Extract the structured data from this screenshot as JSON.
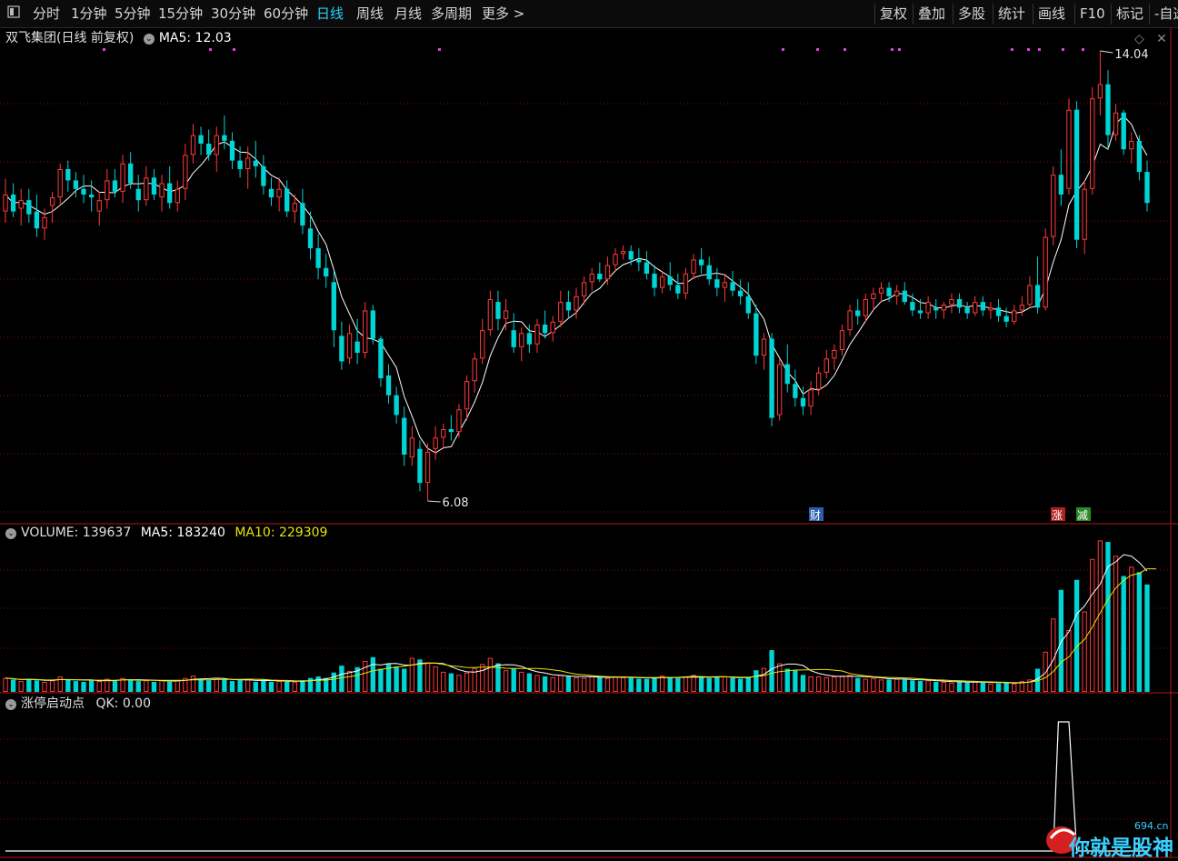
{
  "toolbar": {
    "left_tabs": [
      "分时",
      "1分钟",
      "5分钟",
      "15分钟",
      "30分钟",
      "60分钟",
      "日线",
      "周线",
      "月线",
      "多周期",
      "更多 >"
    ],
    "active_tab": "日线",
    "right_buttons": [
      "复权",
      "叠加",
      "多股",
      "统计",
      "画线",
      "F10",
      "标记",
      "-自选"
    ]
  },
  "price_panel": {
    "title": "双飞集团(日线 前复权)",
    "ma_label": "MA5: 12.03",
    "high_marker": "14.04",
    "low_marker": "6.08",
    "event_badges": [
      "财",
      "涨",
      "减"
    ]
  },
  "volume_panel": {
    "label": "VOLUME: 139637",
    "ma5_label": "MA5: 183240",
    "ma10_label": "MA10: 229309"
  },
  "indicator_panel": {
    "label": "涨停启动点",
    "qk_label": "QK: 0.00"
  },
  "watermark": {
    "text": "你就是股神",
    "site": "694.cn"
  },
  "colors": {
    "up": "#ff3a3a",
    "down": "#00d4d4",
    "ma5": "#ffffff",
    "ma10": "#e6e600",
    "active_tab": "#28d4ff",
    "marker_dot": "#e040e0"
  },
  "chart_data": [
    {
      "type": "candlestick",
      "title": "双飞集团(日线 前复权)",
      "ohlc": [
        [
          11.2,
          11.78,
          11.0,
          11.5
        ],
        [
          11.5,
          11.7,
          11.1,
          11.2
        ],
        [
          11.25,
          11.6,
          10.95,
          11.4
        ],
        [
          11.4,
          11.6,
          11.0,
          11.15
        ],
        [
          11.2,
          11.5,
          10.75,
          10.9
        ],
        [
          10.9,
          11.25,
          10.7,
          11.1
        ],
        [
          11.3,
          11.55,
          11.0,
          11.45
        ],
        [
          11.45,
          12.05,
          11.3,
          11.95
        ],
        [
          11.95,
          12.1,
          11.55,
          11.75
        ],
        [
          11.75,
          11.9,
          11.45,
          11.6
        ],
        [
          11.6,
          11.85,
          11.35,
          11.5
        ],
        [
          11.5,
          11.75,
          11.2,
          11.45
        ],
        [
          11.2,
          11.55,
          10.95,
          11.4
        ],
        [
          11.4,
          11.95,
          11.25,
          11.75
        ],
        [
          11.75,
          11.95,
          11.45,
          11.55
        ],
        [
          11.55,
          12.2,
          11.35,
          12.05
        ],
        [
          12.05,
          12.25,
          11.6,
          11.7
        ],
        [
          11.6,
          11.85,
          11.2,
          11.4
        ],
        [
          11.4,
          12.0,
          11.3,
          11.8
        ],
        [
          11.8,
          11.95,
          11.4,
          11.5
        ],
        [
          11.45,
          11.85,
          11.2,
          11.7
        ],
        [
          11.7,
          12.0,
          11.25,
          11.35
        ],
        [
          11.35,
          11.75,
          11.2,
          11.6
        ],
        [
          11.6,
          12.4,
          11.4,
          12.2
        ],
        [
          12.2,
          12.75,
          12.05,
          12.55
        ],
        [
          12.55,
          12.7,
          12.2,
          12.4
        ],
        [
          12.4,
          12.65,
          12.1,
          12.2
        ],
        [
          12.2,
          12.7,
          11.9,
          12.55
        ],
        [
          12.55,
          12.9,
          12.3,
          12.45
        ],
        [
          12.45,
          12.6,
          11.95,
          12.1
        ],
        [
          12.1,
          12.35,
          11.8,
          11.95
        ],
        [
          11.95,
          12.35,
          11.6,
          12.15
        ],
        [
          12.1,
          12.45,
          11.8,
          12.0
        ],
        [
          12.0,
          12.2,
          11.5,
          11.65
        ],
        [
          11.6,
          11.8,
          11.3,
          11.45
        ],
        [
          11.45,
          11.8,
          11.2,
          11.6
        ],
        [
          11.6,
          11.75,
          11.1,
          11.2
        ],
        [
          11.2,
          11.5,
          11.0,
          11.35
        ],
        [
          11.35,
          11.6,
          10.8,
          10.95
        ],
        [
          10.9,
          11.2,
          10.35,
          10.55
        ],
        [
          10.55,
          10.8,
          10.0,
          10.2
        ],
        [
          10.2,
          10.45,
          9.85,
          10.05
        ],
        [
          9.95,
          10.15,
          8.8,
          9.1
        ],
        [
          9.0,
          9.25,
          8.4,
          8.55
        ],
        [
          8.6,
          9.2,
          8.5,
          9.05
        ],
        [
          8.9,
          9.3,
          8.5,
          8.7
        ],
        [
          8.7,
          9.6,
          8.6,
          9.45
        ],
        [
          9.45,
          9.55,
          8.85,
          8.95
        ],
        [
          8.95,
          9.0,
          8.1,
          8.25
        ],
        [
          8.3,
          8.5,
          7.8,
          7.95
        ],
        [
          7.95,
          8.1,
          7.45,
          7.6
        ],
        [
          7.55,
          7.75,
          6.7,
          6.9
        ],
        [
          6.85,
          7.4,
          6.7,
          7.2
        ],
        [
          7.0,
          7.15,
          6.25,
          6.4
        ],
        [
          6.4,
          7.1,
          6.08,
          6.95
        ],
        [
          7.0,
          7.4,
          6.8,
          7.2
        ],
        [
          7.2,
          7.45,
          7.0,
          7.35
        ],
        [
          7.35,
          7.6,
          7.15,
          7.3
        ],
        [
          7.3,
          7.8,
          7.2,
          7.7
        ],
        [
          7.7,
          8.3,
          7.5,
          8.2
        ],
        [
          8.2,
          8.7,
          8.0,
          8.6
        ],
        [
          8.6,
          9.3,
          8.5,
          9.1
        ],
        [
          9.1,
          9.8,
          9.0,
          9.65
        ],
        [
          9.6,
          9.8,
          9.1,
          9.3
        ],
        [
          9.3,
          9.65,
          9.1,
          9.45
        ],
        [
          9.1,
          9.4,
          8.7,
          8.8
        ],
        [
          8.8,
          9.15,
          8.55,
          9.05
        ],
        [
          9.05,
          9.2,
          8.7,
          8.85
        ],
        [
          8.85,
          9.3,
          8.7,
          9.2
        ],
        [
          9.2,
          9.45,
          8.95,
          9.05
        ],
        [
          9.05,
          9.35,
          8.9,
          9.25
        ],
        [
          9.25,
          9.8,
          9.15,
          9.6
        ],
        [
          9.6,
          9.8,
          9.3,
          9.45
        ],
        [
          9.45,
          9.85,
          9.3,
          9.7
        ],
        [
          9.7,
          10.05,
          9.55,
          9.95
        ],
        [
          9.95,
          10.2,
          9.8,
          10.1
        ],
        [
          10.1,
          10.3,
          9.95,
          10.0
        ],
        [
          10.0,
          10.4,
          9.9,
          10.25
        ],
        [
          10.25,
          10.55,
          10.15,
          10.45
        ],
        [
          10.45,
          10.6,
          10.35,
          10.5
        ],
        [
          10.5,
          10.6,
          10.25,
          10.35
        ],
        [
          10.35,
          10.55,
          10.15,
          10.3
        ],
        [
          10.3,
          10.5,
          10.0,
          10.1
        ],
        [
          10.1,
          10.25,
          9.7,
          9.85
        ],
        [
          9.85,
          10.15,
          9.75,
          10.05
        ],
        [
          10.05,
          10.3,
          9.8,
          9.9
        ],
        [
          9.9,
          10.1,
          9.65,
          9.75
        ],
        [
          9.75,
          10.2,
          9.65,
          10.1
        ],
        [
          10.1,
          10.45,
          10.0,
          10.35
        ],
        [
          10.35,
          10.55,
          10.1,
          10.25
        ],
        [
          10.25,
          10.4,
          9.9,
          10.0
        ],
        [
          10.0,
          10.2,
          9.7,
          9.85
        ],
        [
          9.85,
          10.1,
          9.6,
          9.95
        ],
        [
          9.95,
          10.15,
          9.7,
          9.8
        ],
        [
          9.8,
          10.0,
          9.55,
          9.7
        ],
        [
          9.7,
          9.95,
          9.3,
          9.4
        ],
        [
          9.4,
          9.55,
          8.5,
          8.65
        ],
        [
          8.65,
          9.05,
          8.4,
          8.95
        ],
        [
          8.95,
          9.05,
          7.4,
          7.55
        ],
        [
          7.6,
          8.6,
          7.5,
          8.5
        ],
        [
          8.5,
          8.85,
          8.0,
          8.15
        ],
        [
          8.15,
          8.4,
          7.75,
          7.9
        ],
        [
          7.9,
          8.1,
          7.6,
          7.75
        ],
        [
          7.75,
          8.2,
          7.6,
          8.05
        ],
        [
          8.05,
          8.45,
          7.95,
          8.35
        ],
        [
          8.35,
          8.75,
          8.25,
          8.6
        ],
        [
          8.6,
          8.85,
          8.4,
          8.75
        ],
        [
          8.75,
          9.2,
          8.65,
          9.1
        ],
        [
          9.1,
          9.55,
          9.0,
          9.45
        ],
        [
          9.45,
          9.65,
          9.2,
          9.35
        ],
        [
          9.35,
          9.75,
          9.25,
          9.65
        ],
        [
          9.65,
          9.85,
          9.45,
          9.75
        ],
        [
          9.75,
          9.95,
          9.6,
          9.85
        ],
        [
          9.85,
          9.95,
          9.6,
          9.7
        ],
        [
          9.7,
          9.9,
          9.55,
          9.8
        ],
        [
          9.8,
          9.95,
          9.55,
          9.6
        ],
        [
          9.6,
          9.75,
          9.35,
          9.45
        ],
        [
          9.45,
          9.65,
          9.3,
          9.4
        ],
        [
          9.4,
          9.7,
          9.3,
          9.6
        ],
        [
          9.5,
          9.65,
          9.3,
          9.45
        ],
        [
          9.45,
          9.6,
          9.3,
          9.55
        ],
        [
          9.55,
          9.75,
          9.4,
          9.65
        ],
        [
          9.65,
          9.75,
          9.4,
          9.5
        ],
        [
          9.5,
          9.6,
          9.3,
          9.4
        ],
        [
          9.4,
          9.7,
          9.35,
          9.6
        ],
        [
          9.6,
          9.7,
          9.35,
          9.45
        ],
        [
          9.45,
          9.6,
          9.3,
          9.5
        ],
        [
          9.5,
          9.65,
          9.25,
          9.35
        ],
        [
          9.35,
          9.5,
          9.15,
          9.25
        ],
        [
          9.25,
          9.55,
          9.2,
          9.45
        ],
        [
          9.45,
          9.7,
          9.35,
          9.55
        ],
        [
          9.55,
          10.05,
          9.5,
          9.9
        ],
        [
          9.9,
          10.4,
          9.4,
          9.5
        ],
        [
          9.5,
          10.9,
          9.45,
          10.75
        ],
        [
          10.75,
          12.0,
          10.6,
          11.85
        ],
        [
          11.85,
          12.3,
          11.3,
          11.5
        ],
        [
          11.6,
          13.2,
          11.5,
          13.0
        ],
        [
          13.0,
          13.15,
          10.55,
          10.7
        ],
        [
          10.7,
          11.75,
          10.45,
          11.6
        ],
        [
          11.6,
          13.4,
          11.5,
          13.2
        ],
        [
          13.2,
          14.04,
          12.9,
          13.45
        ],
        [
          13.45,
          13.7,
          12.3,
          12.55
        ],
        [
          12.55,
          13.1,
          12.45,
          12.95
        ],
        [
          12.95,
          13.0,
          12.2,
          12.3
        ],
        [
          12.3,
          12.6,
          12.05,
          12.45
        ],
        [
          12.45,
          12.55,
          11.75,
          11.9
        ],
        [
          11.9,
          12.1,
          11.2,
          11.35
        ]
      ],
      "ma5_last": 12.03,
      "high": 14.04,
      "low": 6.08,
      "grid": true
    },
    {
      "type": "bar",
      "title": "VOLUME",
      "values": [
        18,
        16,
        14,
        17,
        15,
        13,
        15,
        20,
        16,
        14,
        13,
        15,
        14,
        17,
        14,
        18,
        16,
        14,
        15,
        13,
        15,
        13,
        15,
        18,
        21,
        17,
        15,
        18,
        16,
        14,
        15,
        16,
        13,
        16,
        13,
        14,
        13,
        13,
        15,
        18,
        20,
        18,
        25,
        34,
        27,
        32,
        40,
        45,
        30,
        36,
        33,
        30,
        44,
        42,
        38,
        33,
        26,
        24,
        22,
        25,
        31,
        36,
        44,
        37,
        28,
        30,
        26,
        24,
        22,
        20,
        19,
        22,
        20,
        19,
        18,
        20,
        19,
        18,
        20,
        19,
        18,
        17,
        17,
        19,
        21,
        19,
        18,
        20,
        22,
        19,
        18,
        19,
        20,
        18,
        17,
        19,
        28,
        31,
        54,
        37,
        30,
        28,
        22,
        20,
        20,
        19,
        20,
        21,
        22,
        18,
        17,
        18,
        16,
        16,
        17,
        16,
        15,
        14,
        15,
        13,
        13,
        12,
        13,
        12,
        14,
        12,
        11,
        11,
        12,
        11,
        14,
        16,
        30,
        52,
        95,
        132,
        80,
        145,
        104,
        172,
        196,
        194,
        176,
        150,
        162,
        155,
        139
      ],
      "ma5_last": 183240,
      "ma10_last": 229309,
      "volume_last": 139637,
      "grid": true
    },
    {
      "type": "line",
      "title": "涨停启动点",
      "values": [
        0,
        0,
        0,
        0,
        0,
        0,
        0,
        0,
        0,
        0,
        0,
        0,
        0,
        0,
        0,
        0,
        0,
        0,
        0,
        0,
        0,
        0,
        0,
        0,
        0,
        0,
        0,
        0,
        0,
        0,
        0,
        0,
        0,
        0,
        0,
        0,
        0,
        0,
        0,
        0,
        0,
        0,
        0,
        0,
        0,
        0,
        0,
        0,
        0,
        0,
        0,
        0,
        0,
        0,
        0,
        0,
        0,
        0,
        0,
        0,
        0,
        0,
        0,
        0,
        0,
        0,
        0,
        0,
        0,
        0,
        0,
        0,
        0,
        0,
        0,
        0,
        0,
        0,
        0,
        0,
        0,
        0,
        0,
        0,
        0,
        0,
        0,
        0,
        0,
        0,
        0,
        0,
        0,
        0,
        0,
        0,
        0,
        0,
        0,
        0,
        0,
        0,
        0,
        0,
        0,
        0,
        0,
        0,
        0,
        0,
        0,
        0,
        0,
        0,
        0,
        0,
        0,
        0,
        0,
        0,
        0,
        0,
        0,
        0,
        0,
        0,
        0,
        0,
        0,
        0,
        0,
        0,
        0,
        0,
        0,
        1,
        1,
        0,
        0,
        0,
        0,
        0,
        0,
        0,
        0,
        0,
        0
      ],
      "qk_last": 0.0,
      "grid": true
    }
  ]
}
